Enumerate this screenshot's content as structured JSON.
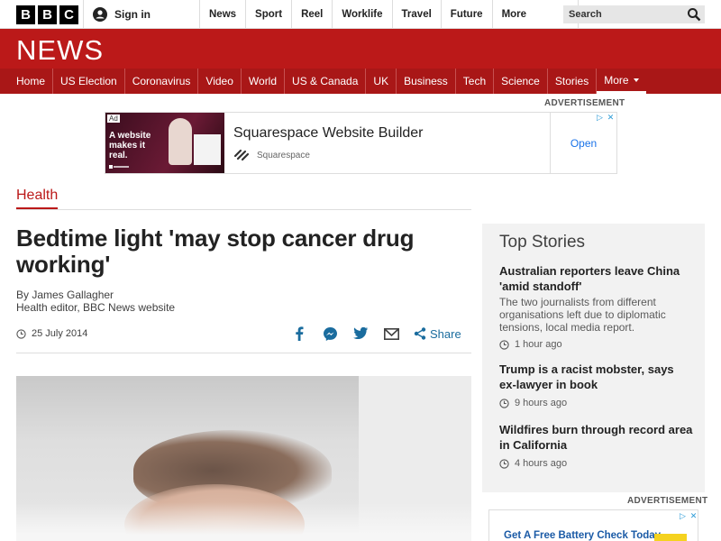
{
  "global_bar": {
    "logo_letters": [
      "B",
      "B",
      "C"
    ],
    "signin_label": "Sign in",
    "nav": [
      "News",
      "Sport",
      "Reel",
      "Worklife",
      "Travel",
      "Future"
    ],
    "more_label": "More",
    "search_placeholder": "Search"
  },
  "masthead": {
    "logo_text": "NEWS",
    "nav": [
      "Home",
      "US Election",
      "Coronavirus",
      "Video",
      "World",
      "US & Canada",
      "UK",
      "Business",
      "Tech",
      "Science",
      "Stories"
    ],
    "more_label": "More"
  },
  "top_ad": {
    "label": "ADVERTISEMENT",
    "tag": "Ad",
    "image_headline": "A website makes it real.",
    "title": "Squarespace Website Builder",
    "sponsor": "Squarespace",
    "cta": "Open"
  },
  "article": {
    "section": "Health",
    "headline": "Bedtime light 'may stop cancer drug working'",
    "author": "By James Gallagher",
    "author_role": "Health editor, BBC News website",
    "date": "25 July 2014",
    "share_label": "Share"
  },
  "sidebar": {
    "title": "Top Stories",
    "stories": [
      {
        "title": "Australian reporters leave China 'amid standoff'",
        "summary": "The two journalists from different organisations left due to diplomatic tensions, local media report.",
        "time": "1 hour ago"
      },
      {
        "title": "Trump is a racist mobster, says ex-lawyer in book",
        "summary": "",
        "time": "9 hours ago"
      },
      {
        "title": "Wildfires burn through record area in California",
        "summary": "",
        "time": "4 hours ago"
      }
    ]
  },
  "side_ad": {
    "label": "ADVERTISEMENT",
    "text": "Get A Free Battery Check Today"
  },
  "colors": {
    "brand_red": "#bb1919",
    "nav_red": "#a91717",
    "link_blue": "#1a6c9e"
  },
  "icons": [
    "user-icon",
    "search-icon",
    "chevron-down-icon",
    "clock-icon",
    "facebook-icon",
    "messenger-icon",
    "twitter-icon",
    "email-icon",
    "share-icon",
    "adchoices-icon"
  ]
}
